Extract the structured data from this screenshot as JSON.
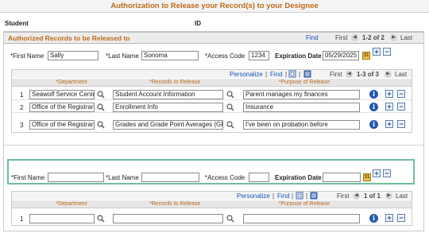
{
  "page": {
    "title": "Authorization to Release your Record(s) to your Designee",
    "student_label": "Student",
    "id_label": "ID"
  },
  "group": {
    "title": "Authorized Records to be Released to",
    "find": "Find",
    "first": "First",
    "count": "1-2 of 2",
    "last": "Last"
  },
  "designee1": {
    "first_name_label": "*First Name",
    "first_name": "Sally",
    "last_name_label": "*Last Name",
    "last_name": "Sonoma",
    "access_code_label": "*Access Code",
    "access_code": "1234",
    "expiration_label": "Expiration Date",
    "expiration": "05/29/2025"
  },
  "grid1": {
    "personalize": "Personalize",
    "find": "Find",
    "first": "First",
    "count": "1-3 of 3",
    "last": "Last",
    "headers": [
      "*Department",
      "*Records to Release",
      "*Purpose of Release"
    ],
    "rows": [
      {
        "num": "1",
        "dept": "Seawolf Service Center",
        "record": "Student Account Information",
        "purpose": "Parent manages my finances"
      },
      {
        "num": "2",
        "dept": "Office of the Registrar and",
        "record": "Enrollment Info",
        "purpose": "Insurance"
      },
      {
        "num": "3",
        "dept": "Office of the Registrar and",
        "record": "Grades and Grade Point Averages (GPA)",
        "purpose": "I've been on probation before"
      }
    ]
  },
  "designee2": {
    "first_name_label": "*First Name",
    "first_name": "",
    "last_name_label": "*Last Name",
    "last_name": "",
    "access_code_label": "*Access Code",
    "access_code": "",
    "expiration_label": "Expiration Date",
    "expiration": ""
  },
  "grid2": {
    "personalize": "Personalize",
    "find": "Find",
    "first": "First",
    "count": "1 of 1",
    "last": "Last",
    "headers": [
      "*Department",
      "*Records to Release",
      "*Purpose of Release"
    ],
    "rows": [
      {
        "num": "1",
        "dept": "",
        "record": "",
        "purpose": ""
      }
    ]
  },
  "icons": {
    "add": "+",
    "remove": "−",
    "info": "i",
    "calendar": "31",
    "prev": "◀",
    "next": "▶",
    "separator": "|"
  },
  "colors": {
    "accent_orange": "#c06a1b",
    "link_blue": "#1a55b8",
    "highlight_green": "#6fbf9a"
  }
}
